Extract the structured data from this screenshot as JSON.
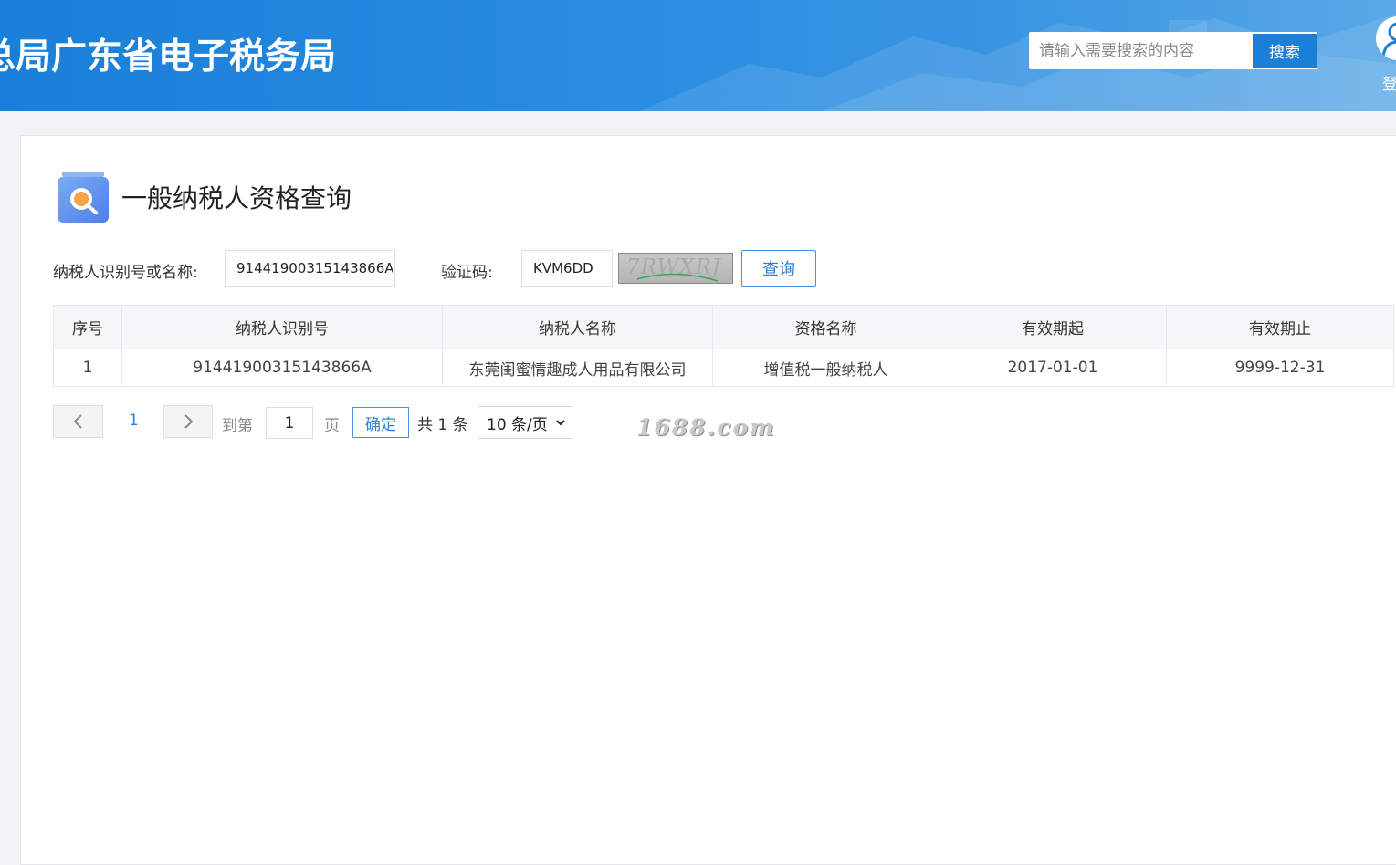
{
  "header": {
    "site_title": "总局广东省电子税务局",
    "search_placeholder": "请输入需要搜索的内容",
    "search_button": "搜索",
    "login_label": "登"
  },
  "page": {
    "title": "一般纳税人资格查询"
  },
  "form": {
    "taxpayer_label": "纳税人识别号或名称:",
    "taxpayer_value": "91441900315143866A",
    "captcha_label": "验证码:",
    "captcha_value": "KVM6DD",
    "captcha_image_text": "7RWXRJ",
    "query_button": "查询"
  },
  "table": {
    "headers": [
      "序号",
      "纳税人识别号",
      "纳税人名称",
      "资格名称",
      "有效期起",
      "有效期止"
    ],
    "rows": [
      [
        "1",
        "91441900315143866A",
        "东莞闺蜜情趣成人用品有限公司",
        "增值税一般纳税人",
        "2017-01-01",
        "9999-12-31"
      ]
    ]
  },
  "pagination": {
    "current_page": "1",
    "goto_label": "到第",
    "goto_value": "1",
    "page_unit": "页",
    "confirm_button": "确定",
    "total_text": "共 1 条",
    "page_size": "10 条/页"
  },
  "watermark": "1688.com",
  "colors": {
    "header_blue": "#1a7fd8",
    "accent": "#2e7fd6"
  }
}
